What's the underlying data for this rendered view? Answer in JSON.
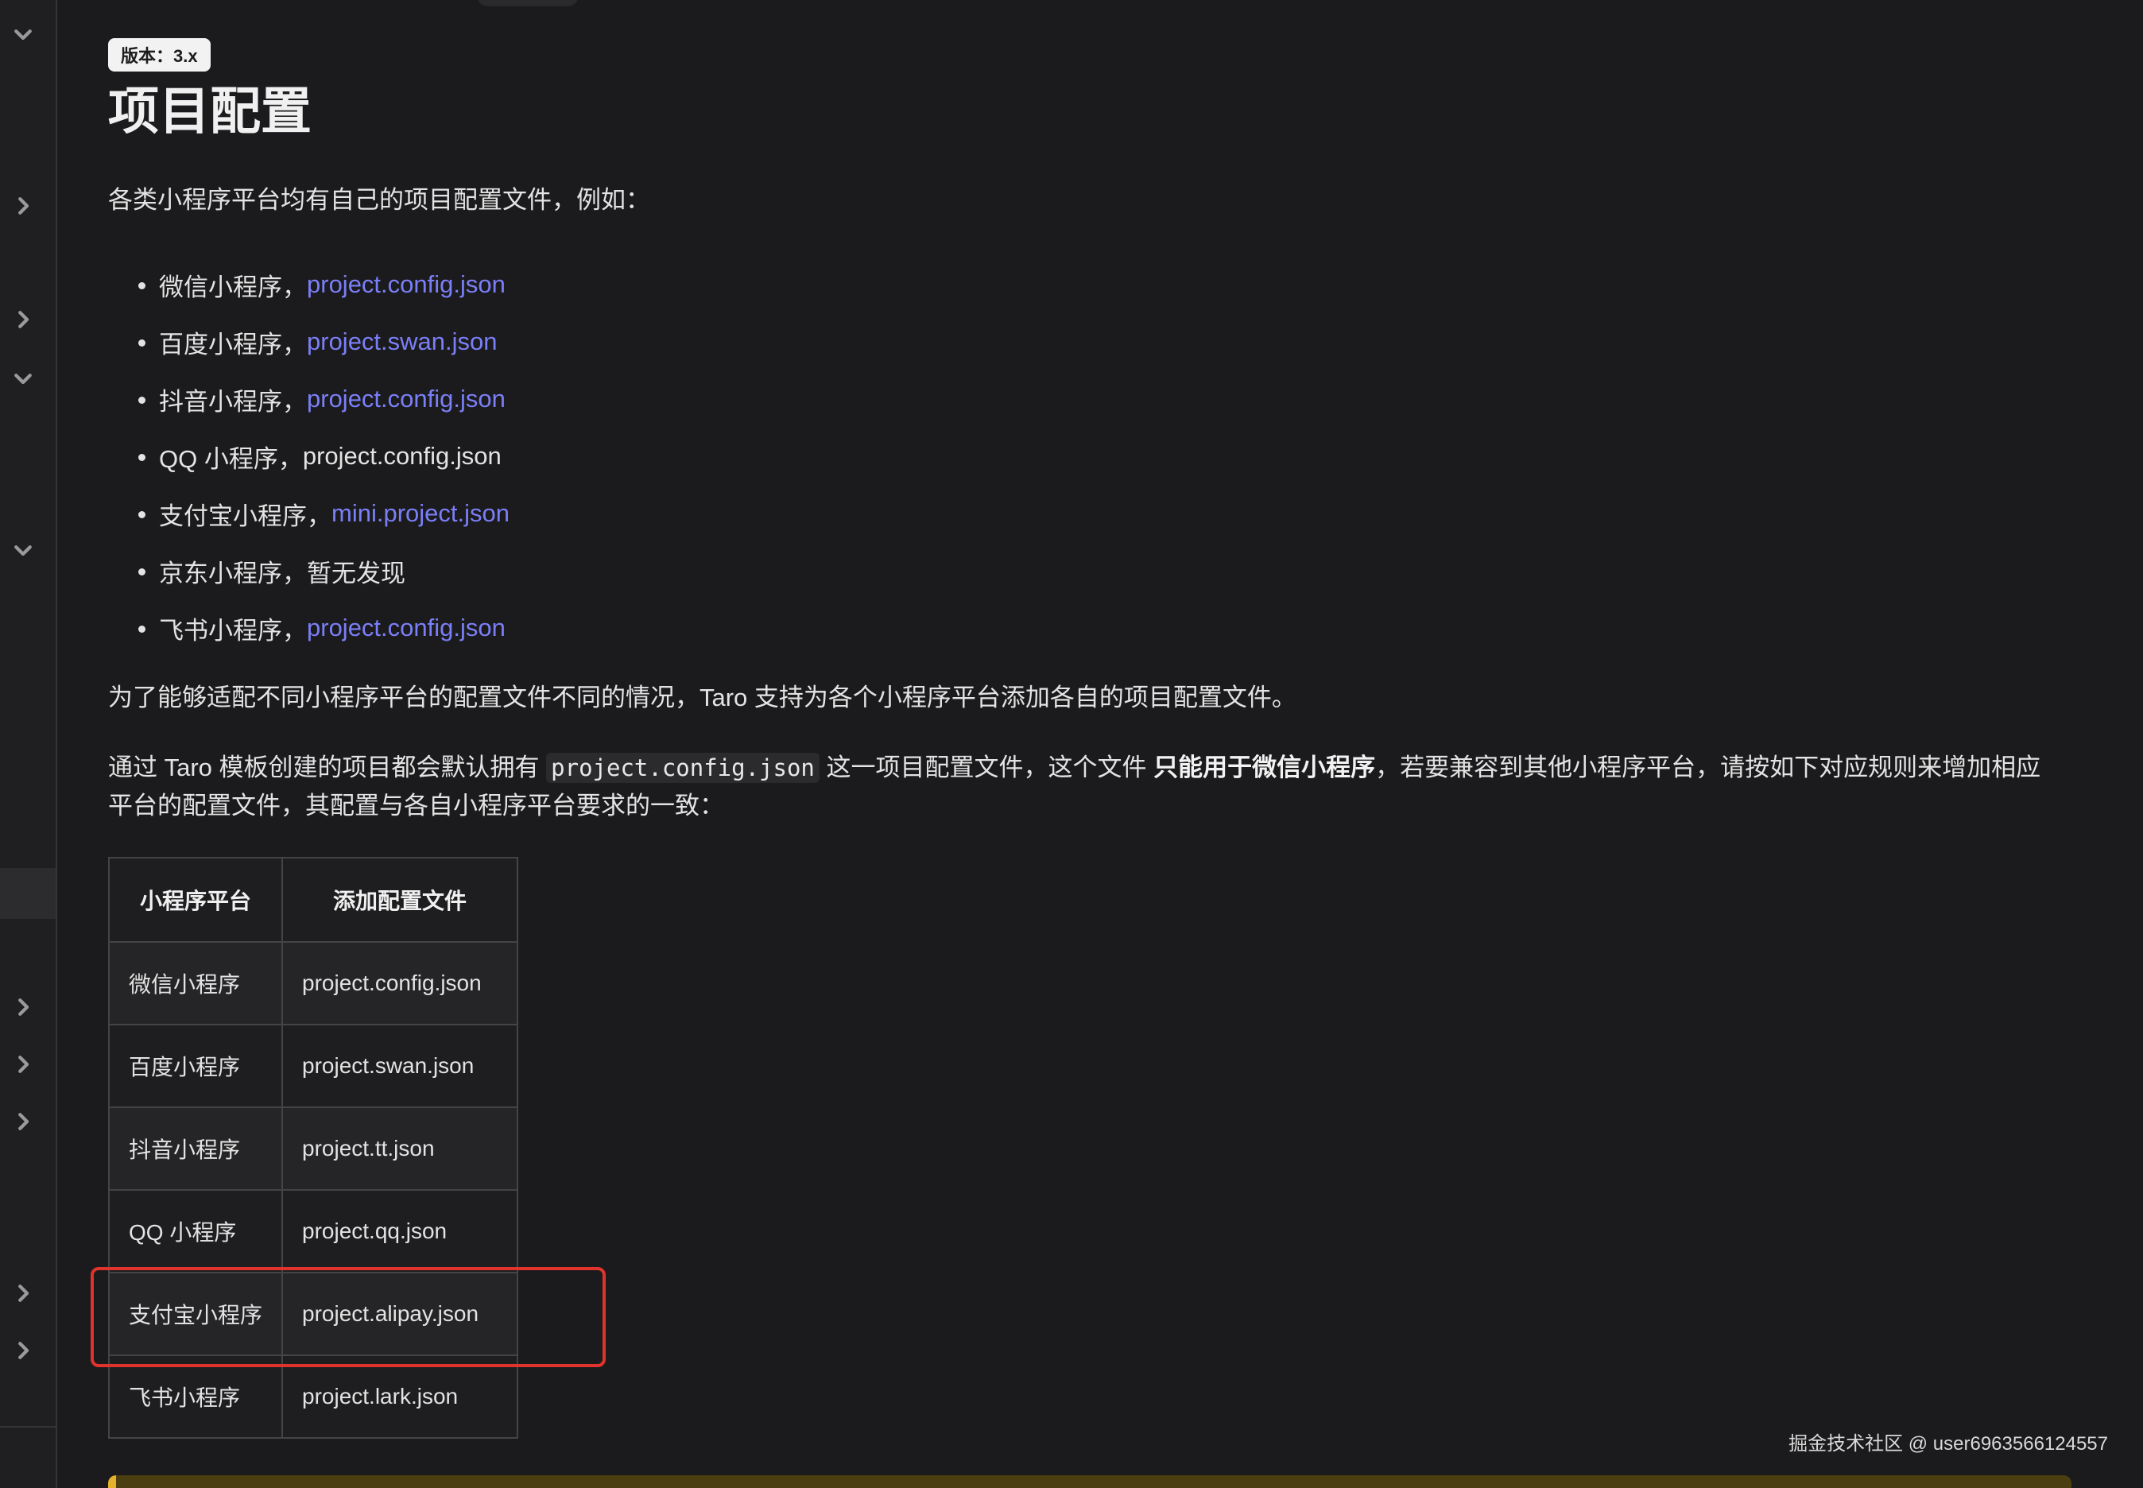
{
  "sidebar": {
    "arrows": [
      "chevron-down",
      "chevron-right",
      "chevron-right",
      "chevron-down",
      "chevron-down",
      "chevron-right",
      "chevron-right",
      "chevron-right",
      "chevron-right",
      "chevron-right"
    ]
  },
  "doc": {
    "version_badge": "版本：3.x",
    "title": "项目配置",
    "intro": "各类小程序平台均有自己的项目配置文件，例如：",
    "platforms": [
      {
        "name": "微信小程序，",
        "file": "project.config.json",
        "is_link": true
      },
      {
        "name": "百度小程序，",
        "file": "project.swan.json",
        "is_link": true
      },
      {
        "name": "抖音小程序，",
        "file": "project.config.json",
        "is_link": true
      },
      {
        "name": "QQ 小程序，",
        "file": "project.config.json",
        "is_link": false
      },
      {
        "name": "支付宝小程序，",
        "file": "mini.project.json",
        "is_link": true
      },
      {
        "name": "京东小程序，",
        "file": "暂无发现",
        "is_link": false
      },
      {
        "name": "飞书小程序，",
        "file": "project.config.json",
        "is_link": true
      }
    ],
    "support_text": "为了能够适配不同小程序平台的配置文件不同的情况，Taro 支持为各个小程序平台添加各自的项目配置文件。",
    "default_text_1": "通过 Taro 模板创建的项目都会默认拥有 ",
    "default_code": "project.config.json",
    "default_text_2": " 这一项目配置文件，这个文件 ",
    "default_bold": "只能用于微信小程序",
    "default_text_3": "，若要兼容到其他小程序平台，请按如下对应规则来增加相应平台的配置文件，其配置与各自小程序平台要求的一致：",
    "table": {
      "headers": [
        "小程序平台",
        "添加配置文件"
      ],
      "rows": [
        [
          "微信小程序",
          "project.config.json"
        ],
        [
          "百度小程序",
          "project.swan.json"
        ],
        [
          "抖音小程序",
          "project.tt.json"
        ],
        [
          "QQ 小程序",
          "project.qq.json"
        ],
        [
          "支付宝小程序",
          "project.alipay.json"
        ],
        [
          "飞书小程序",
          "project.lark.json"
        ]
      ]
    }
  },
  "watermark": "掘金技术社区 @ user6963566124557",
  "colors": {
    "background": "#1b1b1d",
    "link": "#7b7ff7",
    "highlight": "#e0332b",
    "admonition": "#e3b12a"
  }
}
